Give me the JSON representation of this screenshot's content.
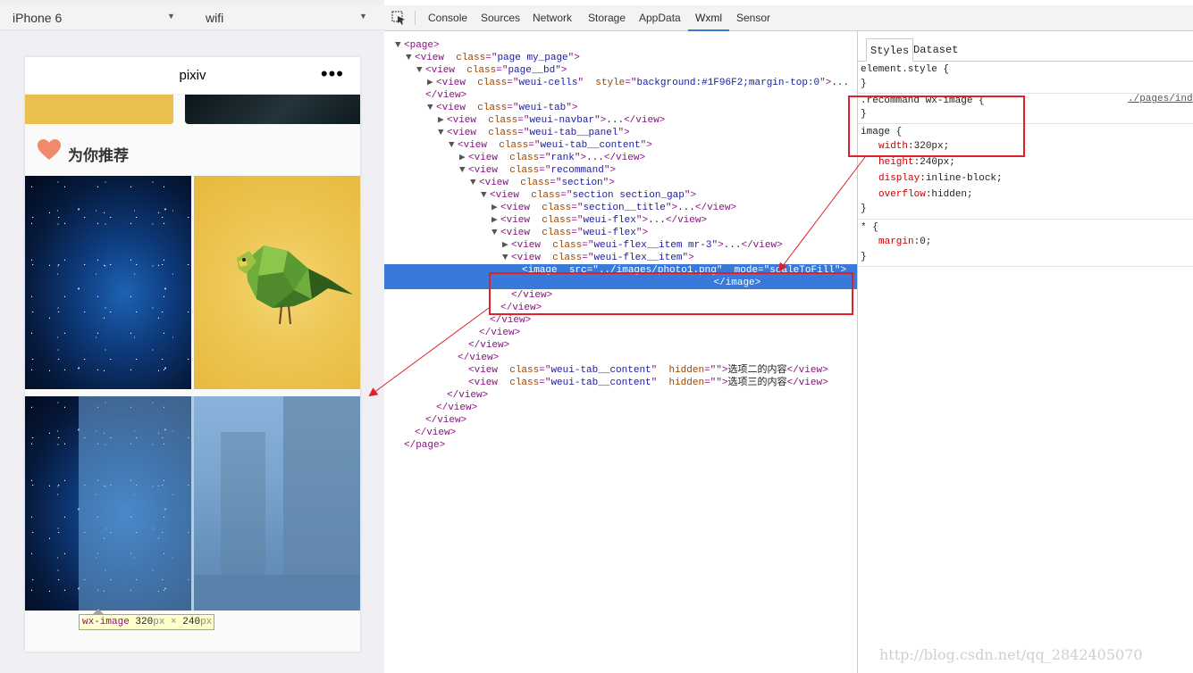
{
  "simulator": {
    "device": "iPhone 6",
    "network": "wifi",
    "phone": {
      "title": "pixiv",
      "menu": "•••",
      "section_title": "为你推荐"
    },
    "tooltip": {
      "tag": "wx-image",
      "width": "320",
      "height": "240",
      "unit": "px",
      "times": "×"
    }
  },
  "devtools": {
    "tabs": [
      "Console",
      "Sources",
      "Network",
      "Storage",
      "AppData",
      "Wxml",
      "Sensor"
    ],
    "active_tab": "Wxml",
    "tree": [
      {
        "indent": 1,
        "tri": "▼",
        "html": "<span class=\"tg\">&lt;page&gt;</span>"
      },
      {
        "indent": 2,
        "tri": "▼",
        "html": "<span class=\"tg\">&lt;view</span>  <span class=\"an\">class</span><span class=\"tg\">=\"</span><span class=\"av\">page my_page</span><span class=\"tg\">\"&gt;</span>"
      },
      {
        "indent": 3,
        "tri": "▼",
        "html": "<span class=\"tg\">&lt;view</span>  <span class=\"an\">class</span><span class=\"tg\">=\"</span><span class=\"av\">page__bd</span><span class=\"tg\">\"&gt;</span>"
      },
      {
        "indent": 4,
        "tri": "▶",
        "html": "<span class=\"tg\">&lt;view</span>  <span class=\"an\">class</span><span class=\"tg\">=\"</span><span class=\"av\">weui-cells</span><span class=\"tg\">\"</span>  <span class=\"an\">style</span><span class=\"tg\">=\"</span><span class=\"av\">background:#1F96F2;margin-top:0</span><span class=\"tg\">\"&gt;</span><span class=\"tx\">...</span>"
      },
      {
        "indent": 3,
        "tri": "",
        "html": "<span class=\"tg\">&lt;/view&gt;</span>"
      },
      {
        "indent": 4,
        "tri": "▼",
        "html": "<span class=\"tg\">&lt;view</span>  <span class=\"an\">class</span><span class=\"tg\">=\"</span><span class=\"av\">weui-tab</span><span class=\"tg\">\"&gt;</span>"
      },
      {
        "indent": 5,
        "tri": "▶",
        "html": "<span class=\"tg\">&lt;view</span>  <span class=\"an\">class</span><span class=\"tg\">=\"</span><span class=\"av\">weui-navbar</span><span class=\"tg\">\"&gt;</span><span class=\"tx\">...</span><span class=\"tg\">&lt;/view&gt;</span>"
      },
      {
        "indent": 5,
        "tri": "▼",
        "html": "<span class=\"tg\">&lt;view</span>  <span class=\"an\">class</span><span class=\"tg\">=\"</span><span class=\"av\">weui-tab__panel</span><span class=\"tg\">\"&gt;</span>"
      },
      {
        "indent": 6,
        "tri": "▼",
        "html": "<span class=\"tg\">&lt;view</span>  <span class=\"an\">class</span><span class=\"tg\">=\"</span><span class=\"av\">weui-tab__content</span><span class=\"tg\">\"&gt;</span>"
      },
      {
        "indent": 7,
        "tri": "▶",
        "html": "<span class=\"tg\">&lt;view</span>  <span class=\"an\">class</span><span class=\"tg\">=\"</span><span class=\"av\">rank</span><span class=\"tg\">\"&gt;</span><span class=\"tx\">...</span><span class=\"tg\">&lt;/view&gt;</span>"
      },
      {
        "indent": 7,
        "tri": "▼",
        "html": "<span class=\"tg\">&lt;view</span>  <span class=\"an\">class</span><span class=\"tg\">=\"</span><span class=\"av\">recommand</span><span class=\"tg\">\"&gt;</span>"
      },
      {
        "indent": 8,
        "tri": "▼",
        "html": "<span class=\"tg\">&lt;view</span>  <span class=\"an\">class</span><span class=\"tg\">=\"</span><span class=\"av\">section</span><span class=\"tg\">\"&gt;</span>"
      },
      {
        "indent": 9,
        "tri": "▼",
        "html": "<span class=\"tg\">&lt;view</span>  <span class=\"an\">class</span><span class=\"tg\">=\"</span><span class=\"av\">section section_gap</span><span class=\"tg\">\"&gt;</span>"
      },
      {
        "indent": 10,
        "tri": "▶",
        "html": "<span class=\"tg\">&lt;view</span>  <span class=\"an\">class</span><span class=\"tg\">=\"</span><span class=\"av\">section__title</span><span class=\"tg\">\"&gt;</span><span class=\"tx\">...</span><span class=\"tg\">&lt;/view&gt;</span>"
      },
      {
        "indent": 10,
        "tri": "▶",
        "html": "<span class=\"tg\">&lt;view</span>  <span class=\"an\">class</span><span class=\"tg\">=\"</span><span class=\"av\">weui-flex</span><span class=\"tg\">\"&gt;</span><span class=\"tx\">...</span><span class=\"tg\">&lt;/view&gt;</span>"
      },
      {
        "indent": 10,
        "tri": "▼",
        "html": "<span class=\"tg\">&lt;view</span>  <span class=\"an\">class</span><span class=\"tg\">=\"</span><span class=\"av\">weui-flex</span><span class=\"tg\">\"&gt;</span>"
      },
      {
        "indent": 11,
        "tri": "▶",
        "html": "<span class=\"tg\">&lt;view</span>  <span class=\"an\">class</span><span class=\"tg\">=\"</span><span class=\"av\">weui-flex__item mr-3</span><span class=\"tg\">\"&gt;</span><span class=\"tx\">...</span><span class=\"tg\">&lt;/view&gt;</span>"
      },
      {
        "indent": 11,
        "tri": "▼",
        "html": "<span class=\"tg\">&lt;view</span>  <span class=\"an\">class</span><span class=\"tg\">=\"</span><span class=\"av\">weui-flex__item</span><span class=\"tg\">\"&gt;</span>"
      },
      {
        "indent": 12,
        "tri": "",
        "sel": true,
        "html": "<span class=\"tg\">&lt;image</span>  <span class=\"an\">src</span><span class=\"tg\">=\"</span><span class=\"av\">../images/photo1.png</span><span class=\"tg\">\"</span>  <span class=\"an\">mode</span><span class=\"tg\">=\"</span><span class=\"av\">scaleToFill</span><span class=\"tg\">\"&gt;</span>\n                                  <span class=\"tg\">&lt;/image&gt;</span>"
      },
      {
        "indent": 11,
        "tri": "",
        "html": "<span class=\"tg\">&lt;/view&gt;</span>"
      },
      {
        "indent": 10,
        "tri": "",
        "html": "<span class=\"tg\">&lt;/view&gt;</span>"
      },
      {
        "indent": 9,
        "tri": "",
        "html": "<span class=\"tg\">&lt;/view&gt;</span>"
      },
      {
        "indent": 8,
        "tri": "",
        "html": "<span class=\"tg\">&lt;/view&gt;</span>"
      },
      {
        "indent": 7,
        "tri": "",
        "html": "<span class=\"tg\">&lt;/view&gt;</span>"
      },
      {
        "indent": 6,
        "tri": "",
        "html": "<span class=\"tg\">&lt;/view&gt;</span>"
      },
      {
        "indent": 7,
        "tri": "",
        "html": "<span class=\"tg\">&lt;view</span>  <span class=\"an\">class</span><span class=\"tg\">=\"</span><span class=\"av\">weui-tab__content</span><span class=\"tg\">\"</span>  <span class=\"an\">hidden</span><span class=\"tg\">=\"\"&gt;</span><span class=\"tx\">选项二的内容</span><span class=\"tg\">&lt;/view&gt;</span>"
      },
      {
        "indent": 7,
        "tri": "",
        "html": "<span class=\"tg\">&lt;view</span>  <span class=\"an\">class</span><span class=\"tg\">=\"</span><span class=\"av\">weui-tab__content</span><span class=\"tg\">\"</span>  <span class=\"an\">hidden</span><span class=\"tg\">=\"\"&gt;</span><span class=\"tx\">选项三的内容</span><span class=\"tg\">&lt;/view&gt;</span>"
      },
      {
        "indent": 5,
        "tri": "",
        "html": "<span class=\"tg\">&lt;/view&gt;</span>"
      },
      {
        "indent": 4,
        "tri": "",
        "html": "<span class=\"tg\">&lt;/view&gt;</span>"
      },
      {
        "indent": 3,
        "tri": "",
        "html": "<span class=\"tg\">&lt;/view&gt;</span>"
      },
      {
        "indent": 2,
        "tri": "",
        "html": "<span class=\"tg\">&lt;/view&gt;</span>"
      },
      {
        "indent": 1,
        "tri": "",
        "html": "<span class=\"tg\">&lt;/page&gt;</span>"
      }
    ],
    "styles": {
      "tabs": [
        "Styles",
        "Dataset"
      ],
      "active_tab": "Styles",
      "element_style": "element.style {",
      "close": "}",
      "rule1_selector": ".recommand wx-image {",
      "rule1_source": "./pages/ind",
      "rule2_selector": "image {",
      "rule2_props": [
        {
          "name": "width",
          "value": "320px;"
        },
        {
          "name": "height",
          "value": "240px;"
        },
        {
          "name": "display",
          "value": "inline-block;"
        },
        {
          "name": "overflow",
          "value": "hidden;"
        }
      ],
      "rule3_selector": "* {",
      "rule3_props": [
        {
          "name": "margin",
          "value": "0;"
        }
      ]
    }
  },
  "watermark": "http://blog.csdn.net/qq_2842405070",
  "colors": {
    "selection": "#3879d9",
    "annotation": "#e0202a",
    "tab_underline": "#3879d9"
  }
}
